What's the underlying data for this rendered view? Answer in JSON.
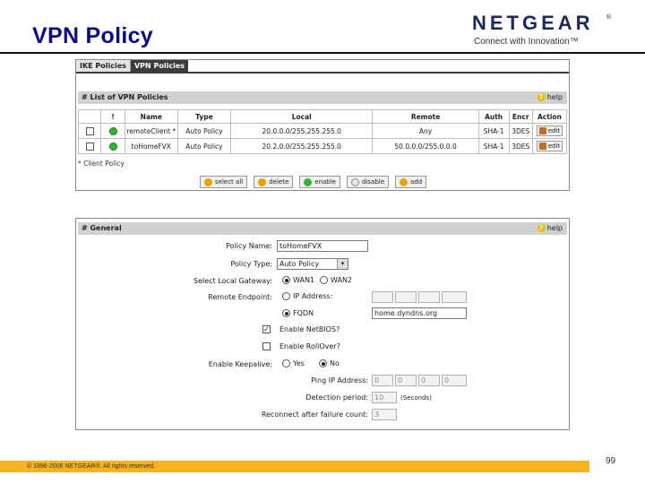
{
  "slide": {
    "title": "VPN Policy",
    "logo_word": "NETGEAR",
    "logo_reg": "®",
    "logo_tagline": "Connect with Innovation™",
    "footer": "© 1996-2006 NETGEAR®. All rights reserved.",
    "page_number": "99"
  },
  "tabs": [
    {
      "label": "IKE Policies",
      "active": false
    },
    {
      "label": "VPN Policies",
      "active": true
    }
  ],
  "list_section": {
    "title": "# List of VPN Policies",
    "help_label": "help",
    "columns": [
      "!",
      "Name",
      "Type",
      "Local",
      "Remote",
      "Auth",
      "Encr",
      "Action"
    ],
    "rows": [
      {
        "name": "remoteClient *",
        "type": "Auto Policy",
        "local": "20.0.0.0/255.255.255.0",
        "remote": "Any",
        "auth": "SHA-1",
        "encr": "3DES",
        "action": "edit",
        "status_color": "#2db82d"
      },
      {
        "name": "toHomeFVX",
        "type": "Auto Policy",
        "local": "20.2.0.0/255.255.255.0",
        "remote": "50.0.0.0/255.0.0.0",
        "auth": "SHA-1",
        "encr": "3DES",
        "action": "edit",
        "status_color": "#2db82d"
      }
    ],
    "client_note": "* Client Policy",
    "buttons": [
      {
        "label": "select all",
        "icon_color": "#e8a400"
      },
      {
        "label": "delete",
        "icon_color": "#e8a400"
      },
      {
        "label": "enable",
        "icon_color": "#2db82d"
      },
      {
        "label": "disable",
        "icon_color": "#e8e8e8"
      },
      {
        "label": "add",
        "icon_color": "#e8a400"
      }
    ]
  },
  "general_section": {
    "title": "# General",
    "help_label": "help",
    "policy_name_label": "Policy Name:",
    "policy_name_value": "toHomeFVX",
    "policy_type_label": "Policy Type:",
    "policy_type_value": "Auto Policy",
    "local_gateway_label": "Select Local Gateway:",
    "wan1_label": "WAN1",
    "wan2_label": "WAN2",
    "remote_endpoint_label": "Remote Endpoint:",
    "ip_address_label": "IP Address:",
    "fqdn_label": "FQDN",
    "fqdn_value": "home.dyndns.org",
    "netbios_label": "Enable NetBIOS?",
    "rollover_label": "Enable RollOver?",
    "keepalive_label": "Enable Keepalive:",
    "yes_label": "Yes",
    "no_label": "No",
    "ping_label": "Ping IP Address:",
    "ping_values": [
      "0",
      "0",
      "0",
      "0"
    ],
    "detection_label": "Detection period:",
    "detection_value": "10",
    "detection_unit": "(Seconds)",
    "reconnect_label": "Reconnect after failure count:",
    "reconnect_value": "3"
  },
  "colors": {
    "title_blue": "#0a0a8c",
    "footer_orange": "#f7b21c",
    "tab_dark": "#3c3c3c",
    "section_gray": "#d0d0d0"
  }
}
